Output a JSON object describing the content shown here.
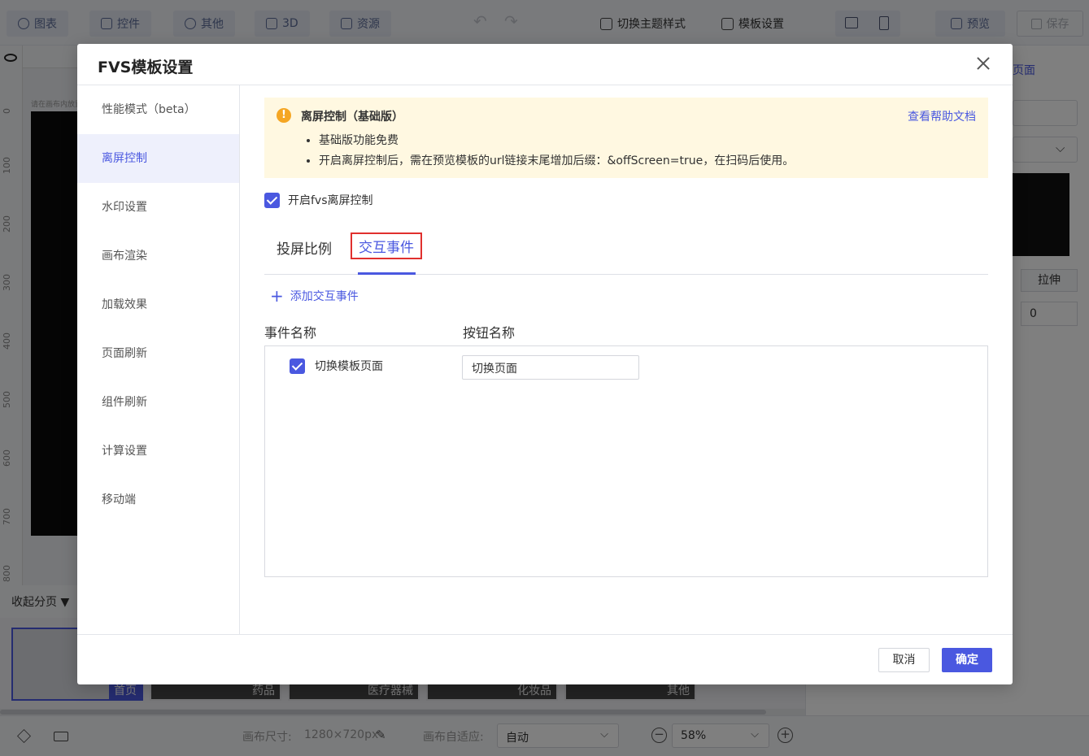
{
  "toolbar": {
    "chart": "图表",
    "widget": "控件",
    "other": "其他",
    "threeD": "3D",
    "resource": "资源",
    "switch_theme": "切换主题样式",
    "template_settings": "模板设置",
    "preview": "预览",
    "save": "保存"
  },
  "canvas": {
    "hint": "请在画布内放置",
    "ruler_ticks": [
      "0",
      "100",
      "200",
      "300",
      "400",
      "500",
      "600",
      "700",
      "800"
    ]
  },
  "pager": {
    "collapse_label": "收起分页",
    "pages": [
      "首页",
      "药品",
      "医疗器械",
      "化妆品",
      "其他"
    ]
  },
  "statusbar": {
    "canvas_size_label": "画布尺寸:",
    "canvas_size_value": "1280×720px",
    "auto_fit_label": "画布自适应:",
    "auto_fit_value": "自动",
    "zoom": "58%"
  },
  "right_panel": {
    "link": "页面",
    "stretch": "拉伸",
    "value": "0"
  },
  "modal": {
    "title": "FVS模板设置",
    "nav": [
      "性能模式（beta）",
      "离屏控制",
      "水印设置",
      "画布渲染",
      "加载效果",
      "页面刷新",
      "组件刷新",
      "计算设置",
      "移动端"
    ],
    "notice": {
      "title": "离屏控制（基础版）",
      "help_link": "查看帮助文档",
      "items": [
        "基础版功能免费",
        "开启离屏控制后，需在预览模板的url链接末尾增加后缀：&offScreen=true，在扫码后使用。"
      ]
    },
    "enable_label": "开启fvs离屏控制",
    "tabs": [
      "投屏比例",
      "交互事件"
    ],
    "add_event": "添加交互事件",
    "columns": [
      "事件名称",
      "按钮名称"
    ],
    "rows": [
      {
        "event": "切换模板页面",
        "button_name": "切换页面",
        "checked": true
      }
    ],
    "cancel": "取消",
    "ok": "确定"
  },
  "colors": {
    "accent": "#4a58e0",
    "notice_bg": "#fff8e1",
    "warning": "#f5a623",
    "highlight_border": "#e0302e"
  }
}
